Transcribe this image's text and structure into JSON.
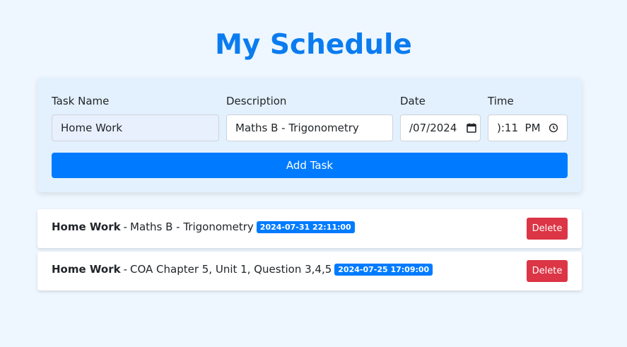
{
  "page": {
    "title": "My Schedule"
  },
  "form": {
    "task_name_label": "Task Name",
    "task_name_value": "Home Work",
    "description_label": "Description",
    "description_value": "Maths B - Trigonometry",
    "date_label": "Date",
    "date_value": "/07/2024",
    "time_label": "Time",
    "time_value": "):11  PM",
    "add_button_label": "Add Task"
  },
  "tasks": [
    {
      "name": "Home Work",
      "separator": "-",
      "description": "Maths B - Trigonometry",
      "datetime": "2024-07-31 22:11:00",
      "delete_label": "Delete"
    },
    {
      "name": "Home Work",
      "separator": "-",
      "description": "COA Chapter 5, Unit 1, Question 3,4,5",
      "datetime": "2024-07-25 17:09:00",
      "delete_label": "Delete"
    }
  ],
  "colors": {
    "accent": "#007bff",
    "title": "#0a7cf0",
    "danger": "#dc3545",
    "background": "#eef6ff",
    "card": "#e3f0fd"
  },
  "icons": {
    "date_picker": "calendar-icon",
    "time_picker": "clock-icon"
  }
}
